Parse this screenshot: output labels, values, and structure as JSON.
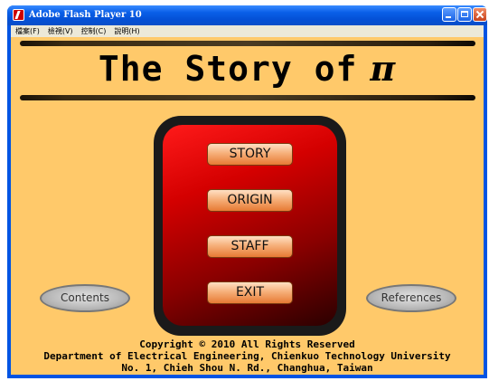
{
  "window": {
    "title": "Adobe Flash Player 10"
  },
  "menubar": {
    "items": [
      "檔案(F)",
      "檢視(V)",
      "控制(C)",
      "說明(H)"
    ]
  },
  "stage": {
    "title": "The Story of",
    "title_symbol": "π",
    "menu": [
      "STORY",
      "ORIGIN",
      "STAFF",
      "EXIT"
    ],
    "left_button": "Contents",
    "right_button": "References",
    "footer": [
      "Copyright © 2010 All Rights Reserved",
      "Department of Electrical Engineering, Chienkuo Technology University",
      "No. 1, Chieh Shou N. Rd., Changhua, Taiwan"
    ]
  },
  "colors": {
    "stage_background": "#ffc96a",
    "titlebar": "#0a5fe8",
    "panel_red": "#d40000",
    "menu_button": "#f6b07a"
  },
  "icons": [
    "flash-player-icon",
    "minimize-icon",
    "maximize-icon",
    "close-icon"
  ]
}
